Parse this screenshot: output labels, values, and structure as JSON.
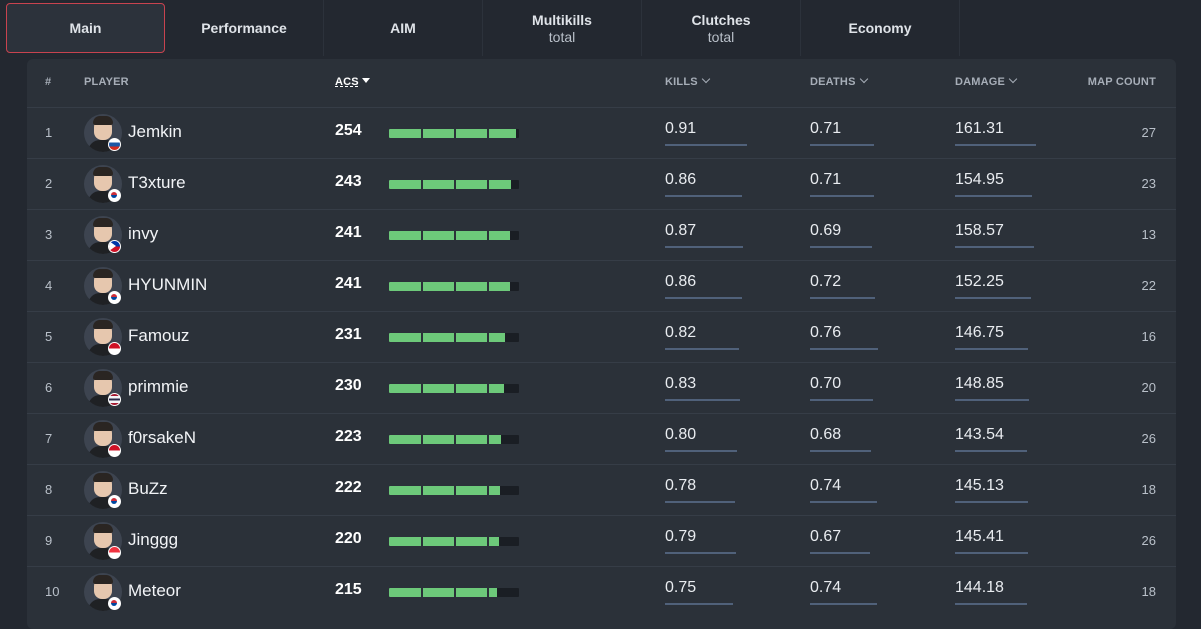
{
  "tabs": [
    {
      "label": "Main",
      "sub": ""
    },
    {
      "label": "Performance",
      "sub": ""
    },
    {
      "label": "AIM",
      "sub": ""
    },
    {
      "label": "Multikills",
      "sub": "total"
    },
    {
      "label": "Clutches",
      "sub": "total"
    },
    {
      "label": "Economy",
      "sub": ""
    }
  ],
  "active_tab": "Main",
  "columns": {
    "rank": "#",
    "player": "PLAYER",
    "acs": "ACS",
    "kills": "KILLS",
    "deaths": "DEATHS",
    "damage": "DAMAGE",
    "map_count": "MAP COUNT"
  },
  "acs_bar_max": 260,
  "stat_bar_scale": {
    "kills": 1.0,
    "deaths": 1.0,
    "damage": 180
  },
  "colors": {
    "accent": "#c8434f",
    "bar_green": "#6dc97a",
    "stat_line": "#50617a"
  },
  "rows": [
    {
      "rank": "1",
      "name": "Jemkin",
      "acs": "254",
      "kills": "0.91",
      "deaths": "0.71",
      "damage": "161.31",
      "maps": "27",
      "flag": "russia-flag-icon"
    },
    {
      "rank": "2",
      "name": "T3xture",
      "acs": "243",
      "kills": "0.86",
      "deaths": "0.71",
      "damage": "154.95",
      "maps": "23",
      "flag": "south-korea-flag-icon"
    },
    {
      "rank": "3",
      "name": "invy",
      "acs": "241",
      "kills": "0.87",
      "deaths": "0.69",
      "damage": "158.57",
      "maps": "13",
      "flag": "philippines-flag-icon"
    },
    {
      "rank": "4",
      "name": "HYUNMIN",
      "acs": "241",
      "kills": "0.86",
      "deaths": "0.72",
      "damage": "152.25",
      "maps": "22",
      "flag": "south-korea-flag-icon"
    },
    {
      "rank": "5",
      "name": "Famouz",
      "acs": "231",
      "kills": "0.82",
      "deaths": "0.76",
      "damage": "146.75",
      "maps": "16",
      "flag": "indonesia-flag-icon"
    },
    {
      "rank": "6",
      "name": "primmie",
      "acs": "230",
      "kills": "0.83",
      "deaths": "0.70",
      "damage": "148.85",
      "maps": "20",
      "flag": "thailand-flag-icon"
    },
    {
      "rank": "7",
      "name": "f0rsakeN",
      "acs": "223",
      "kills": "0.80",
      "deaths": "0.68",
      "damage": "143.54",
      "maps": "26",
      "flag": "indonesia-flag-icon"
    },
    {
      "rank": "8",
      "name": "BuZz",
      "acs": "222",
      "kills": "0.78",
      "deaths": "0.74",
      "damage": "145.13",
      "maps": "18",
      "flag": "south-korea-flag-icon"
    },
    {
      "rank": "9",
      "name": "Jinggg",
      "acs": "220",
      "kills": "0.79",
      "deaths": "0.67",
      "damage": "145.41",
      "maps": "26",
      "flag": "singapore-flag-icon"
    },
    {
      "rank": "10",
      "name": "Meteor",
      "acs": "215",
      "kills": "0.75",
      "deaths": "0.74",
      "damage": "144.18",
      "maps": "18",
      "flag": "south-korea-flag-icon"
    }
  ]
}
